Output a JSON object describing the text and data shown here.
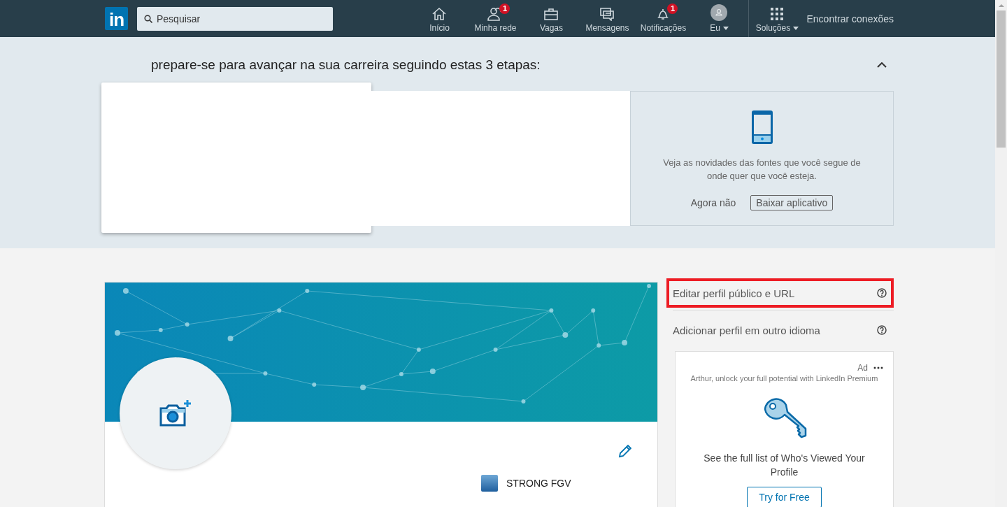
{
  "nav": {
    "logo": "in",
    "search": {
      "placeholder": "Pesquisar"
    },
    "items": [
      {
        "kind": "home",
        "label": "Início",
        "dropdown": false
      },
      {
        "kind": "people",
        "label": "Minha rede",
        "badge": "1",
        "dropdown": false
      },
      {
        "kind": "briefcase",
        "label": "Vagas",
        "dropdown": false
      },
      {
        "kind": "chat",
        "label": "Mensagens",
        "dropdown": false
      },
      {
        "kind": "bell",
        "label": "Notificações",
        "badge": "1",
        "dropdown": false
      },
      {
        "kind": "avatar",
        "label": "Eu",
        "dropdown": true
      }
    ],
    "solutions": {
      "label": "Soluções",
      "dropdown": true
    },
    "find_connections": "Encontrar conexões"
  },
  "prompt": {
    "title": "prepare-se para avançar na sua carreira seguindo estas 3 etapas:",
    "app_card": {
      "text": "Veja as novidades das fontes que você segue de onde quer que você esteja.",
      "dismiss": "Agora não",
      "download": "Baixar aplicativo"
    }
  },
  "profile": {
    "school": "STRONG FGV"
  },
  "sidebar": {
    "links": [
      {
        "label": "Editar perfil público e URL",
        "highlighted": true
      },
      {
        "label": "Adicionar perfil em outro idioma",
        "highlighted": false
      }
    ],
    "ad": {
      "tag": "Ad",
      "headline": "Arthur, unlock your full potential with LinkedIn Premium",
      "text": "See the full list of Who's Viewed Your Profile",
      "button": "Try for Free"
    }
  }
}
